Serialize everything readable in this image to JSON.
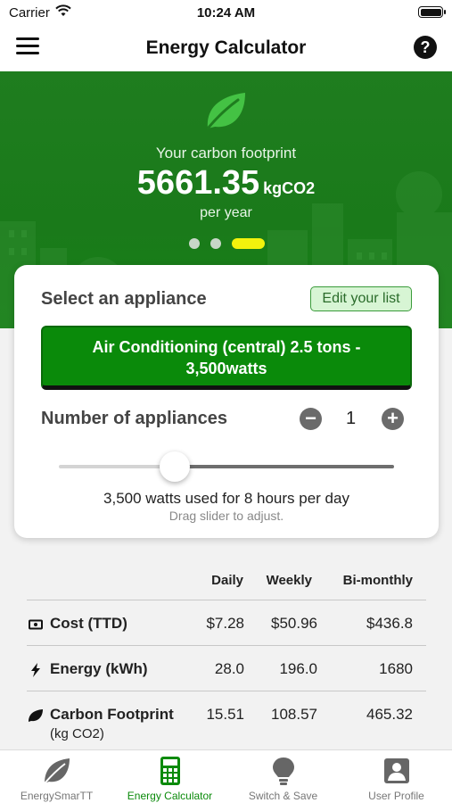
{
  "status_bar": {
    "carrier": "Carrier",
    "time": "10:24 AM"
  },
  "nav": {
    "title": "Energy Calculator",
    "help_symbol": "?"
  },
  "hero": {
    "label": "Your carbon footprint",
    "value": "5661.35",
    "unit": "kgCO2",
    "period": "per year",
    "active_page": 3,
    "page_count": 3
  },
  "card": {
    "heading": "Select an appliance",
    "edit_button": "Edit your list",
    "appliance_line1": "Air Conditioning (central) 2.5 tons -",
    "appliance_line2": "3,500watts",
    "count_label": "Number of appliances",
    "count": "1",
    "minus_symbol": "−",
    "plus_symbol": "+",
    "usage": "3,500 watts used for 8 hours per day",
    "hint": "Drag slider to adjust.",
    "slider_hours": 8,
    "slider_max_hours": 24
  },
  "table": {
    "headers": {
      "daily": "Daily",
      "weekly": "Weekly",
      "bimonthly": "Bi-monthly"
    },
    "rows": [
      {
        "label": "Cost (TTD)",
        "icon": "money-icon",
        "daily": "$7.28",
        "weekly": "$50.96",
        "bimonthly": "$436.8"
      },
      {
        "label": "Energy (kWh)",
        "icon": "lightning-icon",
        "daily": "28.0",
        "weekly": "196.0",
        "bimonthly": "1680"
      },
      {
        "label": "Carbon Footprint",
        "sublabel": "(kg CO2)",
        "icon": "leaf-icon",
        "daily": "15.51",
        "weekly": "108.57",
        "bimonthly": "465.32"
      }
    ]
  },
  "tabs": [
    {
      "label": "EnergySmarTT",
      "icon": "leaf-icon"
    },
    {
      "label": "Energy Calculator",
      "icon": "calculator-icon",
      "active": true
    },
    {
      "label": "Switch & Save",
      "icon": "lightbulb-icon"
    },
    {
      "label": "User Profile",
      "icon": "profile-icon"
    }
  ],
  "colors": {
    "brand_green": "#0a8a0a",
    "indicator_yellow": "#f2f20d"
  }
}
